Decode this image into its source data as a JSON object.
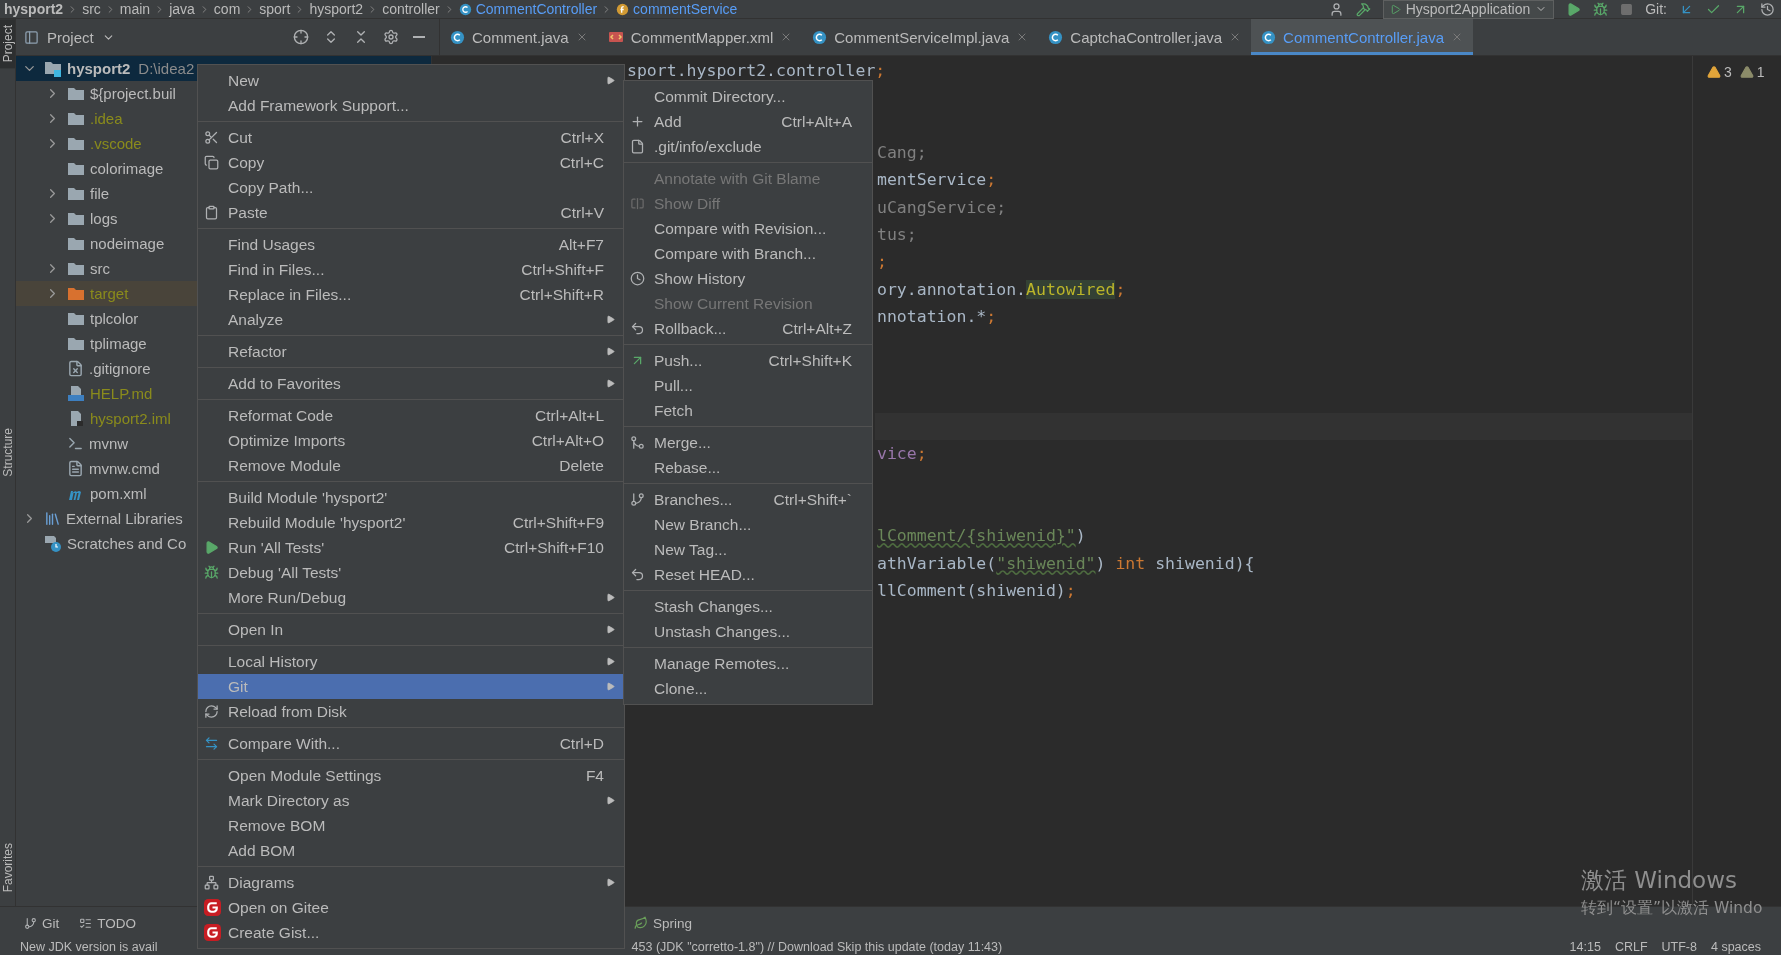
{
  "breadcrumb": [
    {
      "label": "hysport2",
      "kind": "plain"
    },
    {
      "label": "src",
      "kind": "plain"
    },
    {
      "label": "main",
      "kind": "plain"
    },
    {
      "label": "java",
      "kind": "plain"
    },
    {
      "label": "com",
      "kind": "plain"
    },
    {
      "label": "sport",
      "kind": "plain"
    },
    {
      "label": "hysport2",
      "kind": "plain"
    },
    {
      "label": "controller",
      "kind": "plain"
    },
    {
      "label": "CommentController",
      "kind": "class"
    },
    {
      "label": "commentService",
      "kind": "field"
    }
  ],
  "toolbar": {
    "run_config": "Hysport2Application",
    "git_label": "Git:"
  },
  "tool_strip": [
    {
      "label": "Project",
      "selected": true
    },
    {
      "label": "Structure",
      "selected": false
    },
    {
      "label": "Favorites",
      "selected": false
    }
  ],
  "project_panel": {
    "title": "Project"
  },
  "editor_tabs": [
    {
      "label": "Comment.java",
      "kind": "class",
      "selected": false
    },
    {
      "label": "CommentMapper.xml",
      "kind": "xml",
      "selected": false
    },
    {
      "label": "CommentServiceImpl.java",
      "kind": "class",
      "selected": false
    },
    {
      "label": "CaptchaController.java",
      "kind": "class",
      "selected": false
    },
    {
      "label": "CommentController.java",
      "kind": "class",
      "selected": true
    }
  ],
  "tree": [
    {
      "label": "hysport2",
      "path": "D:\\idea2",
      "kind": "module",
      "has_children": true,
      "expanded": true,
      "selected": true,
      "ignored": false,
      "excluded": false,
      "children": [
        {
          "label": "${project.buil",
          "kind": "folder",
          "has_children": true,
          "expanded": false,
          "selected": false,
          "ignored": false,
          "excluded": false
        },
        {
          "label": ".idea",
          "kind": "folder",
          "has_children": true,
          "expanded": false,
          "selected": false,
          "ignored": true,
          "excluded": false
        },
        {
          "label": ".vscode",
          "kind": "folder",
          "has_children": true,
          "expanded": false,
          "selected": false,
          "ignored": true,
          "excluded": false
        },
        {
          "label": "colorimage",
          "kind": "folder",
          "has_children": false,
          "selected": false,
          "ignored": false,
          "excluded": false
        },
        {
          "label": "file",
          "kind": "folder",
          "has_children": true,
          "expanded": false,
          "selected": false,
          "ignored": false,
          "excluded": false
        },
        {
          "label": "logs",
          "kind": "folder",
          "has_children": true,
          "expanded": false,
          "selected": false,
          "ignored": false,
          "excluded": false
        },
        {
          "label": "nodeimage",
          "kind": "folder",
          "has_children": false,
          "selected": false,
          "ignored": false,
          "excluded": false
        },
        {
          "label": "src",
          "kind": "folder",
          "has_children": true,
          "expanded": false,
          "selected": false,
          "ignored": false,
          "excluded": false
        },
        {
          "label": "target",
          "kind": "folder",
          "has_children": true,
          "expanded": false,
          "selected": false,
          "ignored": true,
          "excluded": true
        },
        {
          "label": "tplcolor",
          "kind": "folder",
          "has_children": false,
          "selected": false,
          "ignored": false,
          "excluded": false
        },
        {
          "label": "tplimage",
          "kind": "folder",
          "has_children": false,
          "selected": false,
          "ignored": false,
          "excluded": false
        },
        {
          "label": ".gitignore",
          "kind": "ignore-file",
          "has_children": false,
          "selected": false,
          "ignored": false,
          "excluded": false
        },
        {
          "label": "HELP.md",
          "kind": "markdown",
          "has_children": false,
          "selected": false,
          "ignored": true,
          "excluded": false
        },
        {
          "label": "hysport2.iml",
          "kind": "module-file",
          "has_children": false,
          "selected": false,
          "ignored": true,
          "excluded": false
        },
        {
          "label": "mvnw",
          "kind": "script",
          "has_children": false,
          "selected": false,
          "ignored": false,
          "excluded": false
        },
        {
          "label": "mvnw.cmd",
          "kind": "text",
          "has_children": false,
          "selected": false,
          "ignored": false,
          "excluded": false
        },
        {
          "label": "pom.xml",
          "kind": "maven",
          "has_children": false,
          "selected": false,
          "ignored": false,
          "excluded": false
        }
      ]
    },
    {
      "label": "External Libraries",
      "kind": "library",
      "has_children": true,
      "expanded": false,
      "selected": false,
      "ignored": false,
      "excluded": false
    },
    {
      "label": "Scratches and Co",
      "kind": "scratch",
      "has_children": false,
      "selected": false,
      "ignored": false,
      "excluded": false
    }
  ],
  "code_lines": [
    {
      "segments": [
        {
          "text": "sport.hysport2.controller",
          "kind": "plain"
        },
        {
          "text": ";",
          "kind": "punct"
        }
      ]
    },
    {
      "segments": [
        {
          "text": "Cang;",
          "kind": "dim"
        }
      ]
    },
    {
      "segments": [
        {
          "text": "mentService",
          "kind": "plain"
        },
        {
          "text": ";",
          "kind": "punct"
        }
      ]
    },
    {
      "segments": [
        {
          "text": "uCangService;",
          "kind": "dim"
        }
      ]
    },
    {
      "segments": [
        {
          "text": "tus;",
          "kind": "dim"
        }
      ]
    },
    {
      "segments": [
        {
          "text": ";",
          "kind": "punct"
        }
      ]
    },
    {
      "segments": [
        {
          "text": "ory.annotation.",
          "kind": "plain"
        },
        {
          "text": "Autowired",
          "kind": "annotation"
        },
        {
          "text": ";",
          "kind": "punct"
        }
      ]
    },
    {
      "segments": [
        {
          "text": "nnotation.*",
          "kind": "plain"
        },
        {
          "text": ";",
          "kind": "punct"
        }
      ]
    },
    {
      "segments": [
        {
          "text": "vice",
          "kind": "field"
        },
        {
          "text": ";",
          "kind": "punct"
        }
      ]
    },
    {
      "segments": [
        {
          "text": "lComment/{shiwenid}\"",
          "kind": "string"
        },
        {
          "text": ")",
          "kind": "plain"
        }
      ]
    },
    {
      "segments": [
        {
          "text": "athVariable(",
          "kind": "plain"
        },
        {
          "text": "\"shiwenid\"",
          "kind": "string"
        },
        {
          "text": ") ",
          "kind": "plain"
        },
        {
          "text": "int",
          "kind": "keyword"
        },
        {
          "text": " shiwenid){",
          "kind": "plain"
        }
      ]
    },
    {
      "segments": [
        {
          "text": "llComment(shiwenid)",
          "kind": "plain"
        },
        {
          "text": ";",
          "kind": "punct"
        }
      ]
    }
  ],
  "inspections": [
    {
      "count": "3",
      "kind": "warning"
    },
    {
      "count": "1",
      "kind": "weak"
    }
  ],
  "context_menu": {
    "groups": [
      [
        {
          "label": "New",
          "kind": "plain",
          "submenu": true,
          "selected": false
        },
        {
          "label": "Add Framework Support...",
          "kind": "plain",
          "submenu": false,
          "selected": false
        }
      ],
      [
        {
          "label": "Cut",
          "shortcut": "Ctrl+X",
          "kind": "cut",
          "submenu": false,
          "selected": false
        },
        {
          "label": "Copy",
          "shortcut": "Ctrl+C",
          "kind": "copy",
          "submenu": false,
          "selected": false
        },
        {
          "label": "Copy Path...",
          "kind": "plain",
          "submenu": false,
          "selected": false
        },
        {
          "label": "Paste",
          "shortcut": "Ctrl+V",
          "kind": "paste",
          "submenu": false,
          "selected": false
        }
      ],
      [
        {
          "label": "Find Usages",
          "shortcut": "Alt+F7",
          "kind": "plain",
          "submenu": false,
          "selected": false
        },
        {
          "label": "Find in Files...",
          "shortcut": "Ctrl+Shift+F",
          "kind": "plain",
          "submenu": false,
          "selected": false
        },
        {
          "label": "Replace in Files...",
          "shortcut": "Ctrl+Shift+R",
          "kind": "plain",
          "submenu": false,
          "selected": false
        },
        {
          "label": "Analyze",
          "kind": "plain",
          "submenu": true,
          "selected": false
        }
      ],
      [
        {
          "label": "Refactor",
          "kind": "plain",
          "submenu": true,
          "selected": false
        }
      ],
      [
        {
          "label": "Add to Favorites",
          "kind": "plain",
          "submenu": true,
          "selected": false
        }
      ],
      [
        {
          "label": "Reformat Code",
          "shortcut": "Ctrl+Alt+L",
          "kind": "plain",
          "submenu": false,
          "selected": false
        },
        {
          "label": "Optimize Imports",
          "shortcut": "Ctrl+Alt+O",
          "kind": "plain",
          "submenu": false,
          "selected": false
        },
        {
          "label": "Remove Module",
          "shortcut": "Delete",
          "kind": "plain",
          "submenu": false,
          "selected": false
        }
      ],
      [
        {
          "label": "Build Module 'hysport2'",
          "kind": "plain",
          "submenu": false,
          "selected": false
        },
        {
          "label": "Rebuild Module 'hysport2'",
          "shortcut": "Ctrl+Shift+F9",
          "kind": "plain",
          "submenu": false,
          "selected": false
        },
        {
          "label": "Run 'All Tests'",
          "shortcut": "Ctrl+Shift+F10",
          "kind": "run",
          "submenu": false,
          "selected": false
        },
        {
          "label": "Debug 'All Tests'",
          "kind": "debug",
          "submenu": false,
          "selected": false
        },
        {
          "label": "More Run/Debug",
          "kind": "plain",
          "submenu": true,
          "selected": false
        }
      ],
      [
        {
          "label": "Open In",
          "kind": "plain",
          "submenu": true,
          "selected": false
        }
      ],
      [
        {
          "label": "Local History",
          "kind": "plain",
          "submenu": true,
          "selected": false
        },
        {
          "label": "Git",
          "kind": "plain",
          "submenu": true,
          "selected": true
        },
        {
          "label": "Reload from Disk",
          "kind": "reload",
          "submenu": false,
          "selected": false
        }
      ],
      [
        {
          "label": "Compare With...",
          "shortcut": "Ctrl+D",
          "kind": "compare",
          "submenu": false,
          "selected": false
        }
      ],
      [
        {
          "label": "Open Module Settings",
          "shortcut": "F4",
          "kind": "plain",
          "submenu": false,
          "selected": false
        },
        {
          "label": "Mark Directory as",
          "kind": "plain",
          "submenu": true,
          "selected": false
        },
        {
          "label": "Remove BOM",
          "kind": "plain",
          "submenu": false,
          "selected": false
        },
        {
          "label": "Add BOM",
          "kind": "plain",
          "submenu": false,
          "selected": false
        }
      ],
      [
        {
          "label": "Diagrams",
          "kind": "diagrams",
          "submenu": true,
          "selected": false
        },
        {
          "label": "Open on Gitee",
          "kind": "gitee",
          "submenu": false,
          "selected": false
        },
        {
          "label": "Create Gist...",
          "kind": "gitee",
          "submenu": false,
          "selected": false
        }
      ]
    ]
  },
  "git_menu": {
    "groups": [
      [
        {
          "label": "Commit Directory...",
          "kind": "plain",
          "disabled": false
        },
        {
          "label": "Add",
          "shortcut": "Ctrl+Alt+A",
          "kind": "add",
          "disabled": false
        },
        {
          "label": ".git/info/exclude",
          "kind": "exclude",
          "disabled": false
        }
      ],
      [
        {
          "label": "Annotate with Git Blame",
          "kind": "plain",
          "disabled": true
        },
        {
          "label": "Show Diff",
          "kind": "diff",
          "disabled": true
        },
        {
          "label": "Compare with Revision...",
          "kind": "plain",
          "disabled": false
        },
        {
          "label": "Compare with Branch...",
          "kind": "plain",
          "disabled": false
        },
        {
          "label": "Show History",
          "kind": "history",
          "disabled": false
        },
        {
          "label": "Show Current Revision",
          "kind": "plain",
          "disabled": true
        },
        {
          "label": "Rollback...",
          "shortcut": "Ctrl+Alt+Z",
          "kind": "rollback",
          "disabled": false
        }
      ],
      [
        {
          "label": "Push...",
          "shortcut": "Ctrl+Shift+K",
          "kind": "push",
          "disabled": false
        },
        {
          "label": "Pull...",
          "kind": "plain",
          "disabled": false
        },
        {
          "label": "Fetch",
          "kind": "plain",
          "disabled": false
        }
      ],
      [
        {
          "label": "Merge...",
          "kind": "merge",
          "disabled": false
        },
        {
          "label": "Rebase...",
          "kind": "plain",
          "disabled": false
        }
      ],
      [
        {
          "label": "Branches...",
          "shortcut": "Ctrl+Shift+`",
          "kind": "branches",
          "disabled": false
        },
        {
          "label": "New Branch...",
          "kind": "plain",
          "disabled": false
        },
        {
          "label": "New Tag...",
          "kind": "plain",
          "disabled": false
        },
        {
          "label": "Reset HEAD...",
          "kind": "rollback",
          "disabled": false
        }
      ],
      [
        {
          "label": "Stash Changes...",
          "kind": "plain",
          "disabled": false
        },
        {
          "label": "Unstash Changes...",
          "kind": "plain",
          "disabled": false
        }
      ],
      [
        {
          "label": "Manage Remotes...",
          "kind": "plain",
          "disabled": false
        },
        {
          "label": "Clone...",
          "kind": "plain",
          "disabled": false
        }
      ]
    ]
  },
  "tool_tabs": [
    {
      "label": "Git",
      "kind": "git"
    },
    {
      "label": "TODO",
      "kind": "todo"
    },
    {
      "label": "Spring",
      "kind": "spring"
    }
  ],
  "status_bar": {
    "message": "New JDK version is avail",
    "update": "453 (JDK \"corretto-1.8\") // Download   Skip this update (today 11:43)",
    "items": [
      "14:15",
      "CRLF",
      "UTF-8",
      "4 spaces"
    ]
  },
  "activation_notice": {
    "title": "激活 Windows",
    "hint": "转到“设置”以激活 Windo"
  }
}
